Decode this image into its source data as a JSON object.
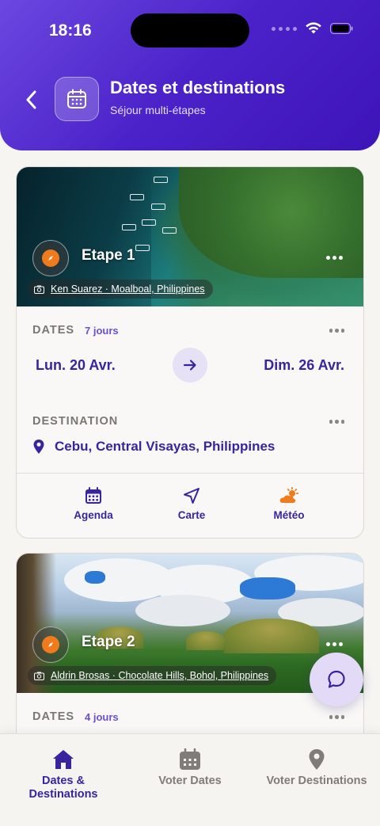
{
  "status": {
    "time": "18:16"
  },
  "header": {
    "title": "Dates et destinations",
    "subtitle": "Séjour multi-étapes"
  },
  "colors": {
    "primary": "#3a249e",
    "accent": "#f07b1d",
    "header_gradient": [
      "#6c47e0",
      "#3d14b8"
    ]
  },
  "stages": [
    {
      "name": "Etape 1",
      "photo_credit": "Ken Suarez · Moalboal, Philippines",
      "dates_label": "DATES",
      "days": "7 jours",
      "start": "Lun. 20 Avr.",
      "end": "Dim. 26 Avr.",
      "destination_label": "DESTINATION",
      "destination": "Cebu, Central Visayas, Philippines",
      "actions": [
        {
          "label": "Agenda",
          "icon": "calendar-icon"
        },
        {
          "label": "Carte",
          "icon": "navigation-arrow-icon"
        },
        {
          "label": "Météo",
          "icon": "weather-sun-cloud-icon"
        }
      ]
    },
    {
      "name": "Etape 2",
      "photo_credit": "Aldrin Brosas · Chocolate Hills, Bohol, Philippines",
      "dates_label": "DATES",
      "days": "4 jours"
    }
  ],
  "bottom_nav": [
    {
      "label": "Dates & Destinations",
      "icon": "home-icon",
      "active": true
    },
    {
      "label": "Voter Dates",
      "icon": "calendar-icon",
      "active": false
    },
    {
      "label": "Voter Destinations",
      "icon": "map-pin-icon",
      "active": false
    }
  ]
}
